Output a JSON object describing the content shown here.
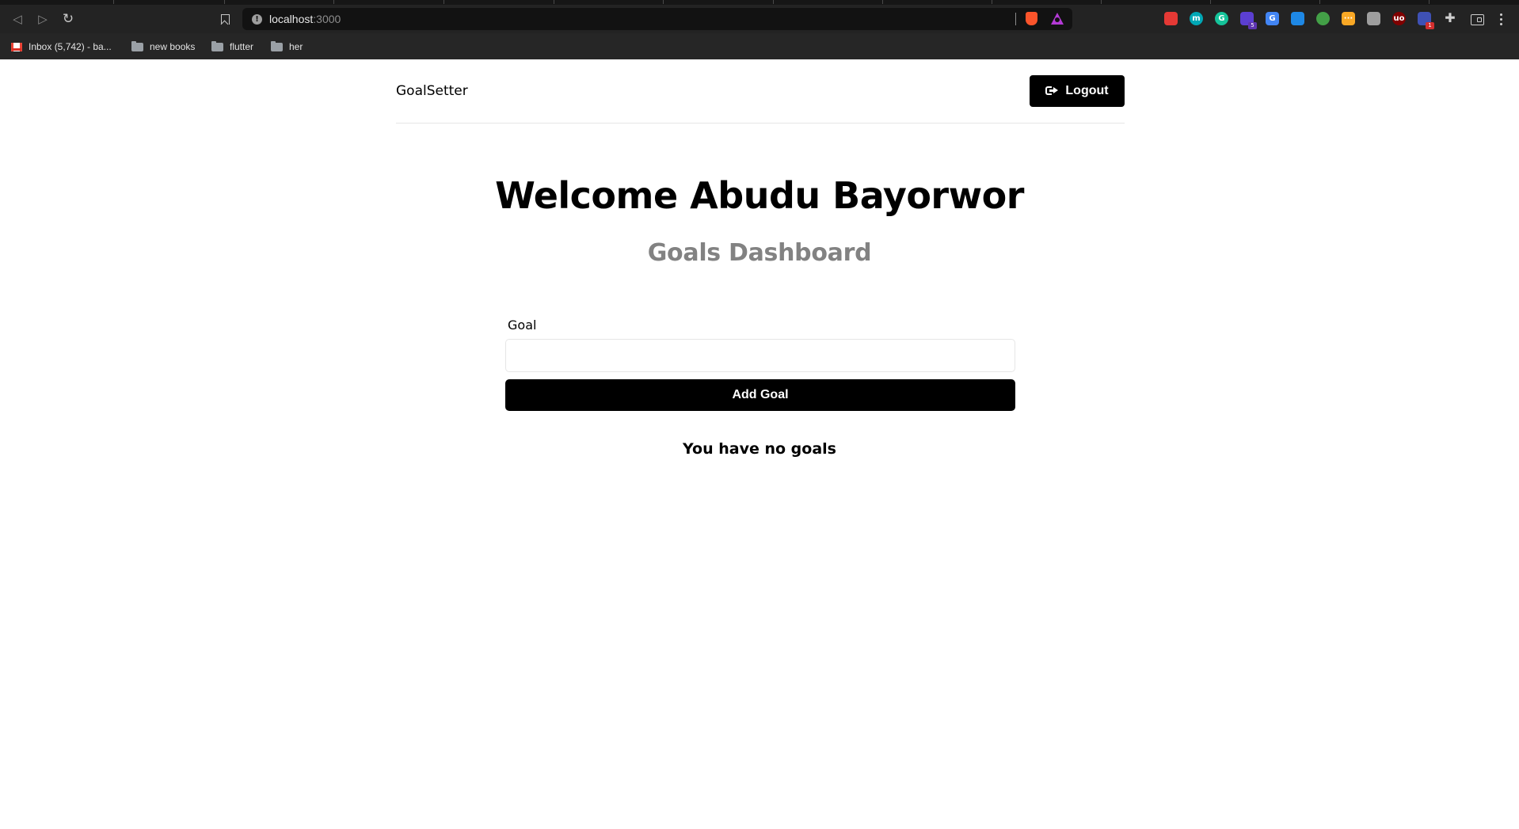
{
  "browser": {
    "url_host": "localhost",
    "url_port": ":3000",
    "bookmarks": [
      {
        "label": "Inbox (5,742) - ba...",
        "icon": "gmail-icon"
      },
      {
        "label": "new books",
        "icon": "folder-icon"
      },
      {
        "label": "flutter",
        "icon": "folder-icon"
      },
      {
        "label": "her",
        "icon": "folder-icon"
      }
    ],
    "extensions": [
      {
        "icon": "red-extension-icon",
        "color": "#e53935"
      },
      {
        "icon": "m-extension-icon",
        "color": "#00a7b5",
        "glyph": "m"
      },
      {
        "icon": "grammarly-icon",
        "color": "#15c39a",
        "glyph": "G"
      },
      {
        "icon": "purple-extension-icon",
        "color": "#5b3fd1",
        "badge": "5"
      },
      {
        "icon": "google-translate-icon",
        "color": "#4285f4",
        "glyph": "G"
      },
      {
        "icon": "eye-extension-icon",
        "color": "#1e88e5"
      },
      {
        "icon": "green-ring-extension-icon",
        "color": "#43a047"
      },
      {
        "icon": "yellow-extension-icon",
        "color": "#f9a825",
        "glyph": "···"
      },
      {
        "icon": "pen-extension-icon",
        "color": "#9e9e9e"
      },
      {
        "icon": "ublock-icon",
        "color": "#800000",
        "glyph": "uo"
      },
      {
        "icon": "blue-gear-extension-icon",
        "color": "#3f51b5",
        "badge": "1"
      }
    ]
  },
  "app": {
    "brand": "GoalSetter",
    "logout_label": "Logout",
    "welcome": "Welcome Abudu Bayorwor",
    "subtitle": "Goals Dashboard",
    "form": {
      "goal_label": "Goal",
      "goal_value": "",
      "submit_label": "Add Goal"
    },
    "empty_message": "You have no goals"
  },
  "colors": {
    "primary": "#000000",
    "subtitle": "#828282",
    "border": "#e6e6e6"
  }
}
